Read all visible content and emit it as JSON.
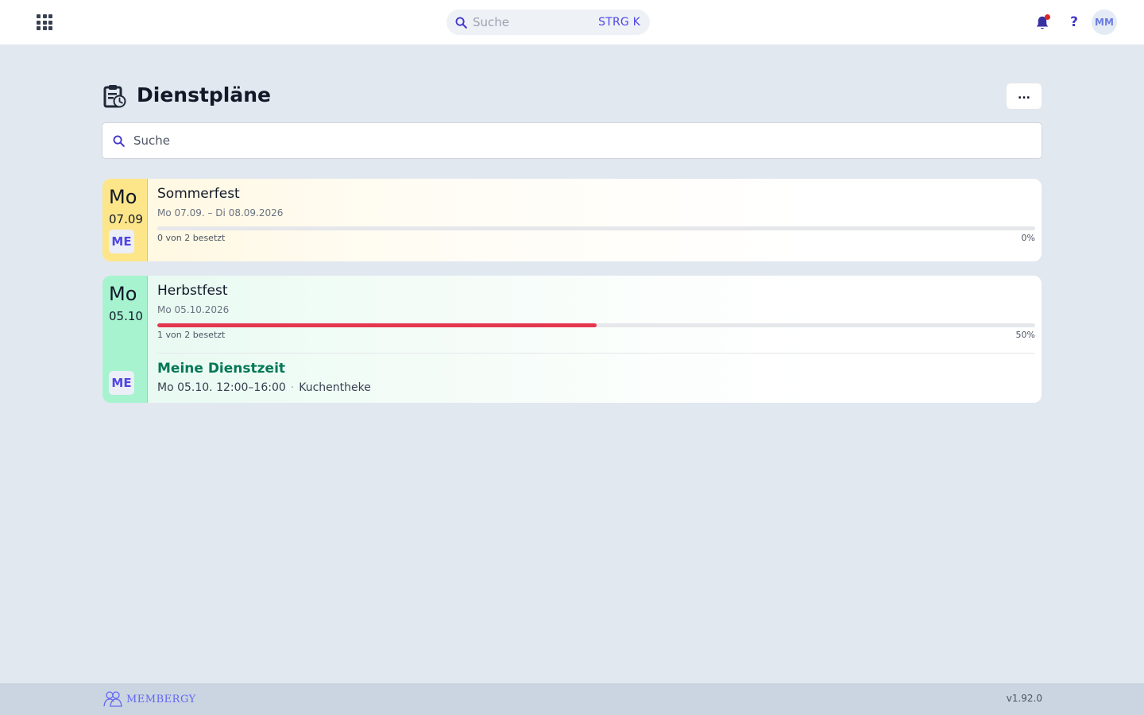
{
  "topbar": {
    "search_placeholder": "Suche",
    "search_shortcut": "STRG K",
    "avatar_initials": "MM",
    "help_label": "?",
    "has_notification": true
  },
  "page": {
    "title": "Dienstpläne",
    "more_label": "...",
    "search_placeholder": "Suche"
  },
  "plans": [
    {
      "weekday": "Mo",
      "day_month": "07.09",
      "title": "Sommerfest",
      "date_range": "Mo 07.09. – Di 08.09.2026",
      "occupancy": "0 von 2 besetzt",
      "percent_label": "0%",
      "fill_fraction": 0,
      "badge": "ME",
      "color": "#fde68a"
    },
    {
      "weekday": "Mo",
      "day_month": "05.10",
      "title": "Herbstfest",
      "date_range": "Mo 05.10.2026",
      "occupancy": "1 von 2 besetzt",
      "percent_label": "50%",
      "fill_fraction": 0.5,
      "badge": "ME",
      "color": "#a7f3d0",
      "my_shift": {
        "heading": "Meine Dienstzeit",
        "time": "Mo 05.10. 12:00–16:00",
        "separator": "·",
        "location": "Kuchentheke"
      }
    }
  ],
  "footer": {
    "brand": "MEMBERGY",
    "version": "v1.92.0"
  },
  "colors": {
    "accent": "#4f46e5",
    "progress": "#e5364f",
    "my_shift": "#047857"
  }
}
